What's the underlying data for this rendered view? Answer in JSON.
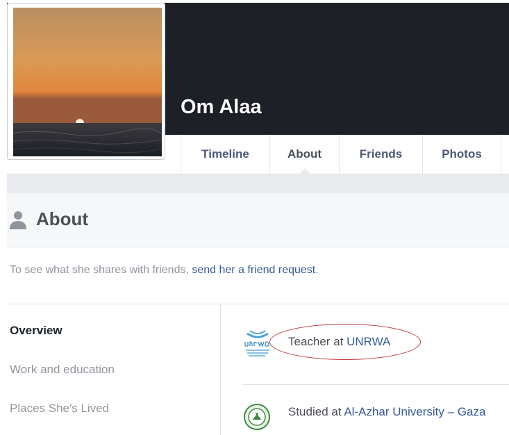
{
  "profile": {
    "name": "Om Alaa"
  },
  "tabs": [
    {
      "label": "Timeline"
    },
    {
      "label": "About"
    },
    {
      "label": "Friends"
    },
    {
      "label": "Photos"
    }
  ],
  "about": {
    "title": "About",
    "notice_prefix": "To see what she shares with friends, ",
    "notice_link": "send her a friend request",
    "notice_suffix": "."
  },
  "sidebar": {
    "items": [
      {
        "label": "Overview"
      },
      {
        "label": "Work and education"
      },
      {
        "label": "Places She's Lived"
      }
    ]
  },
  "overview": {
    "entries": [
      {
        "prefix": "Teacher at ",
        "link": "UNRWA",
        "icon": "unrwa-logo-icon"
      },
      {
        "prefix": "Studied at ",
        "link": "Al-Azhar University – Gaza",
        "icon": "university-seal-icon"
      }
    ]
  },
  "colors": {
    "cover": "#1d2027",
    "link": "#365899",
    "highlight": "#c0393b"
  }
}
